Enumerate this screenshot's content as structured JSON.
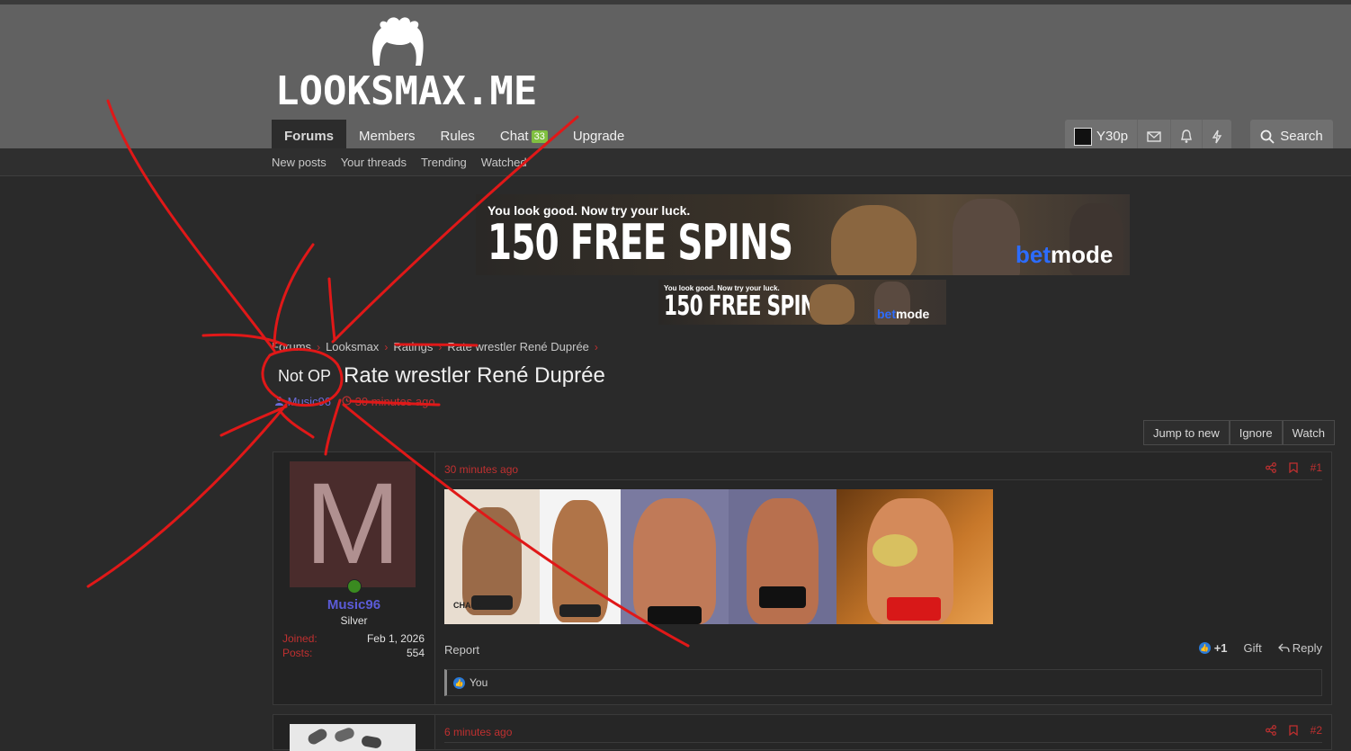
{
  "site": {
    "logo_text": "LOOKSMAX.ME"
  },
  "nav": {
    "tabs": [
      {
        "label": "Forums"
      },
      {
        "label": "Members"
      },
      {
        "label": "Rules"
      },
      {
        "label": "Chat"
      },
      {
        "label": "Upgrade"
      }
    ],
    "chat_count": "33",
    "username": "Y30p",
    "search_label": "Search"
  },
  "subnav": {
    "items": [
      "New posts",
      "Your threads",
      "Trending",
      "Watched"
    ]
  },
  "ads": {
    "tagline": "You look good. Now try your luck.",
    "headline": "150 FREE SPINS",
    "brand_part1": "bet",
    "brand_part2": "mode"
  },
  "breadcrumb": [
    "Forums",
    "Looksmax",
    "Ratings",
    "Rate wrestler René Duprée"
  ],
  "thread": {
    "prefix": "Not OP",
    "title": "Rate wrestler René Duprée",
    "author": "Music96",
    "time": "30 minutes ago"
  },
  "thread_actions": [
    "Jump to new",
    "Ignore",
    "Watch"
  ],
  "post1": {
    "time": "30 minutes ago",
    "number": "#1",
    "avatar_letter": "M",
    "username": "Music96",
    "rank": "Silver",
    "joined_label": "Joined:",
    "joined_value": "Feb 1, 2026",
    "posts_label": "Posts:",
    "posts_value": "554",
    "image_caption": "CHAOS",
    "report": "Report",
    "reactions": "+1",
    "gift": "Gift",
    "reply": "Reply",
    "liked_by": "You"
  },
  "post2": {
    "time": "6 minutes ago",
    "number": "#2"
  },
  "colors": {
    "accent_red": "#c03030",
    "username_blue": "#5b5bd8",
    "header_bg": "#616161",
    "annotation_red": "#e01818"
  }
}
